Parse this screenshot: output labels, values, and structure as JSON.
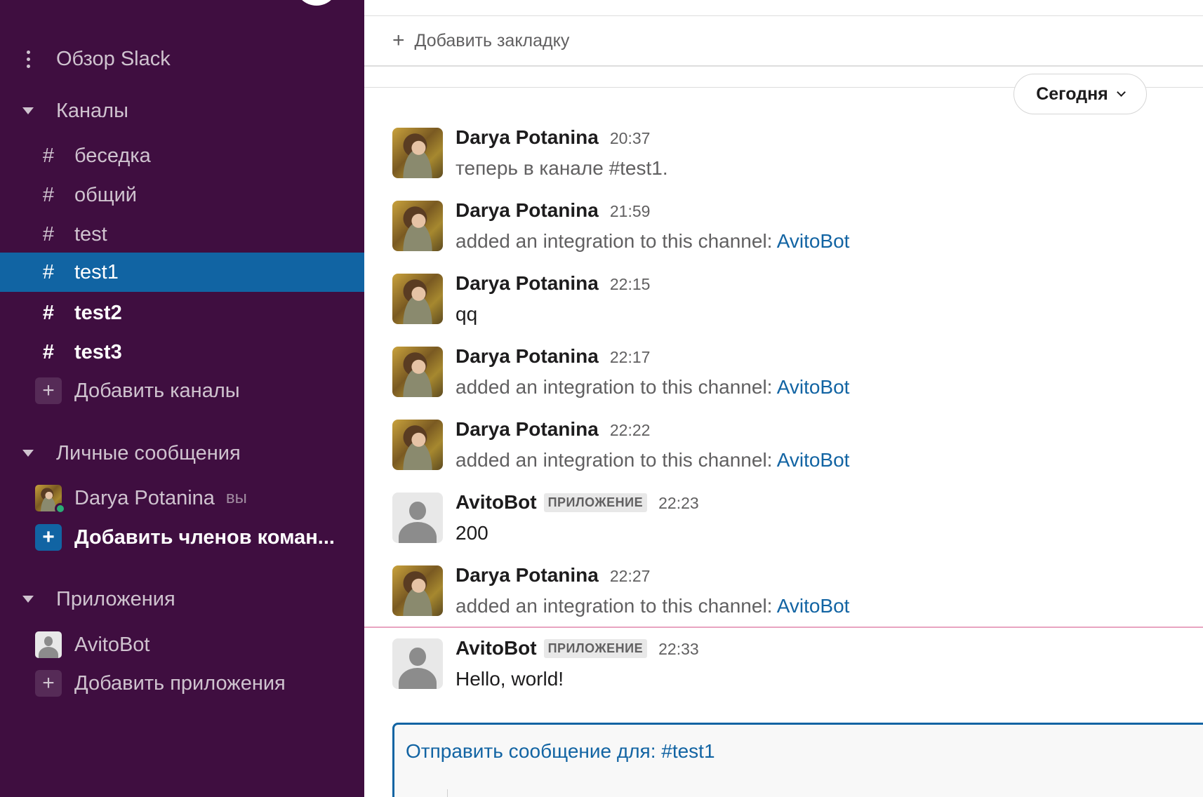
{
  "sidebar": {
    "overview_label": "Обзор Slack",
    "channels_header": "Каналы",
    "channels": [
      {
        "name": "беседка",
        "state": "normal"
      },
      {
        "name": "общий",
        "state": "normal"
      },
      {
        "name": "test",
        "state": "normal"
      },
      {
        "name": "test1",
        "state": "active"
      },
      {
        "name": "test2",
        "state": "unread"
      },
      {
        "name": "test3",
        "state": "unread"
      }
    ],
    "add_channels_label": "Добавить каналы",
    "dm_header": "Личные сообщения",
    "dm_user_name": "Darya Potanina",
    "dm_you_label": "вы",
    "add_members_label": "Добавить членов коман...",
    "apps_header": "Приложения",
    "app_name": "AvitoBot",
    "add_apps_label": "Добавить приложения"
  },
  "header": {
    "add_bookmark_label": "Добавить закладку"
  },
  "date_divider": {
    "label": "Сегодня"
  },
  "messages": [
    {
      "author": "Darya Potanina",
      "time": "20:37",
      "text": "теперь в канале #test1.",
      "system": true
    },
    {
      "author": "Darya Potanina",
      "time": "21:59",
      "text": "added an integration to this channel: ",
      "link": "AvitoBot",
      "system": true
    },
    {
      "author": "Darya Potanina",
      "time": "22:15",
      "text": "qq",
      "system": false
    },
    {
      "author": "Darya Potanina",
      "time": "22:17",
      "text": "added an integration to this channel: ",
      "link": "AvitoBot",
      "system": true
    },
    {
      "author": "Darya Potanina",
      "time": "22:22",
      "text": "added an integration to this channel: ",
      "link": "AvitoBot",
      "system": true
    },
    {
      "author": "AvitoBot",
      "badge": "ПРИЛОЖЕНИЕ",
      "time": "22:23",
      "text": "200",
      "system": false
    },
    {
      "author": "Darya Potanina",
      "time": "22:27",
      "text": "added an integration to this channel: ",
      "link": "AvitoBot",
      "system": true
    },
    {
      "author": "AvitoBot",
      "badge": "ПРИЛОЖЕНИЕ",
      "time": "22:33",
      "text": "Hello, world!",
      "system": false
    }
  ],
  "composer": {
    "placeholder": "Отправить сообщение для: #test1"
  },
  "colors": {
    "sidebar_bg": "#3f0e40",
    "active_channel": "#1164a3",
    "link": "#1264a3",
    "new_message_line": "#e8a4c0"
  }
}
